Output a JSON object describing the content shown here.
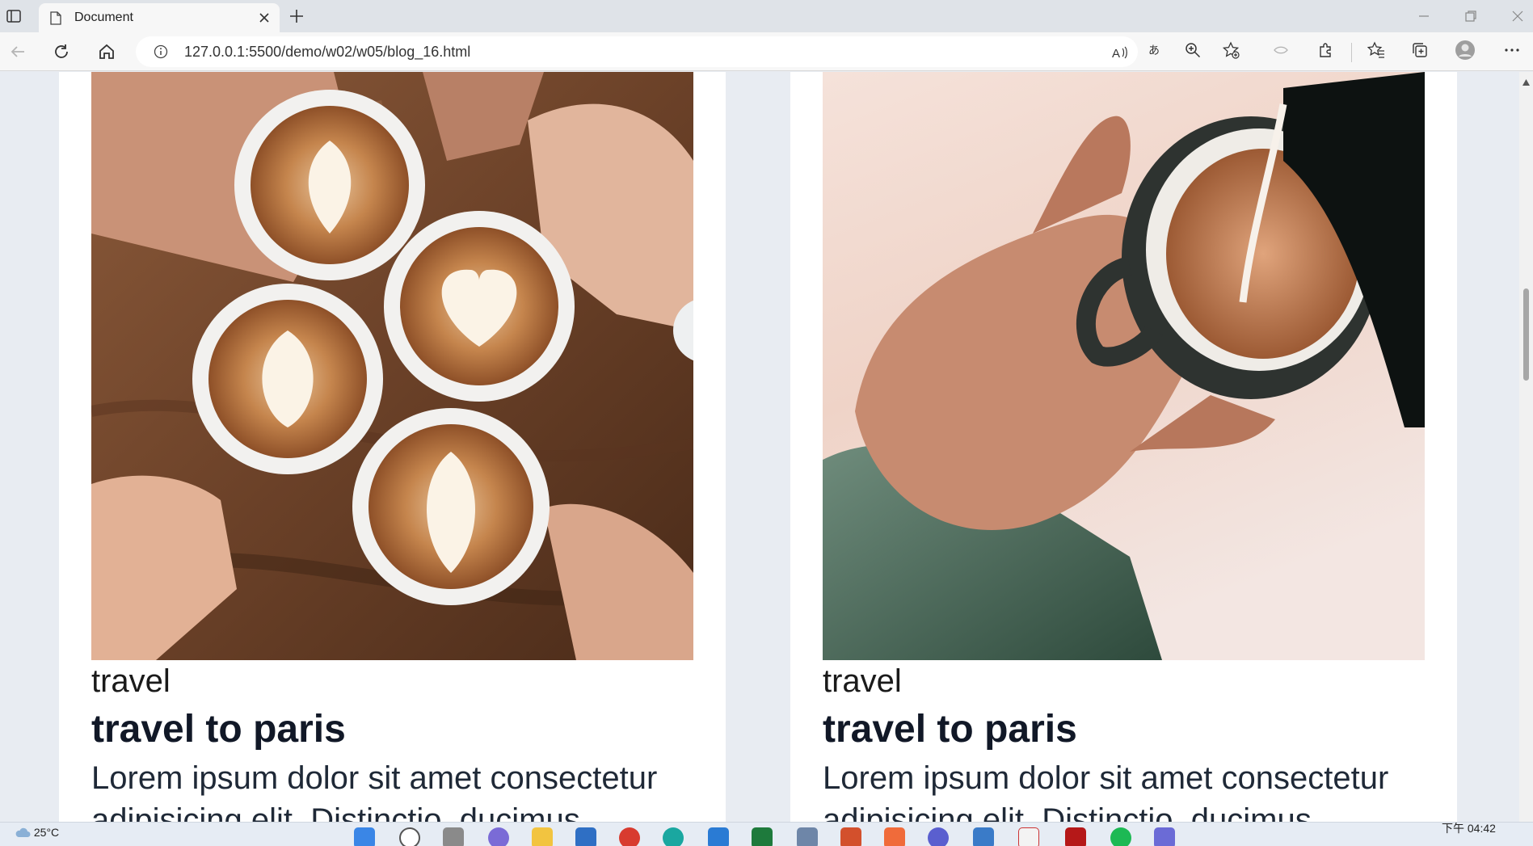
{
  "browser": {
    "tab_title": "Document",
    "url": "127.0.0.1:5500/demo/w02/w05/blog_16.html"
  },
  "cards": [
    {
      "image": "latte-art-cups-photo",
      "category": "travel",
      "title": "travel to paris",
      "excerpt": "Lorem ipsum dolor sit amet consectetur adipisicing elit. Distinctio, ducimus"
    },
    {
      "image": "pouring-milk-coffee-photo",
      "category": "travel",
      "title": "travel to paris",
      "excerpt": "Lorem ipsum dolor sit amet consectetur adipisicing elit. Distinctio, ducimus"
    }
  ],
  "taskbar": {
    "temperature": "25°C",
    "clock": "下午 04:42"
  }
}
